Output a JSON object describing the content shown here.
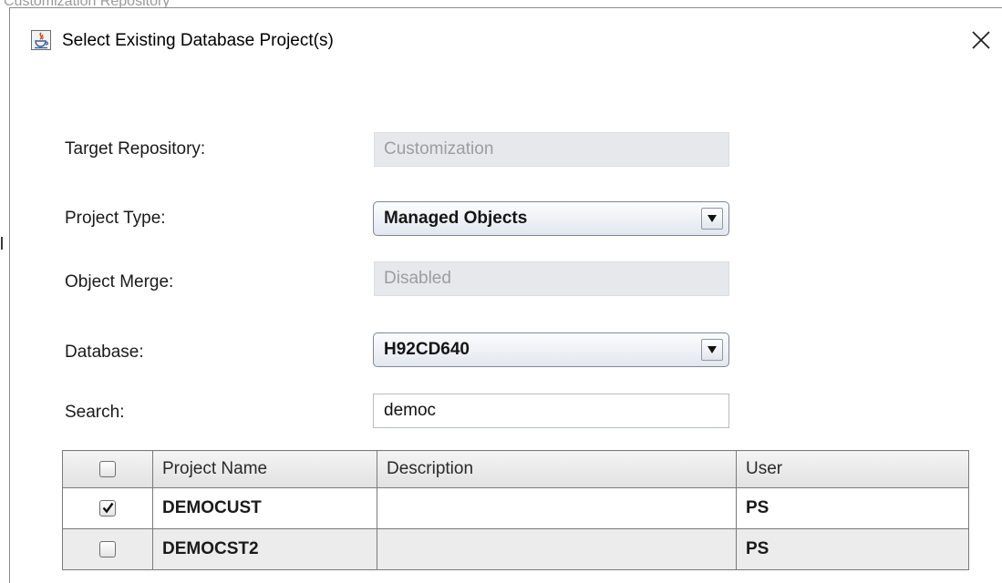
{
  "background_window": {
    "title": "Customization Repository"
  },
  "dialog": {
    "title": "Select Existing Database Project(s)",
    "icon": "java-app-icon",
    "close_icon": "close-icon"
  },
  "form": {
    "target_repository": {
      "label": "Target Repository:",
      "value": "Customization"
    },
    "project_type": {
      "label": "Project Type:",
      "value": "Managed Objects"
    },
    "object_merge": {
      "label": "Object Merge:",
      "value": "Disabled"
    },
    "database": {
      "label": "Database:",
      "value": "H92CD640"
    },
    "search": {
      "label": "Search:",
      "value": "democ"
    }
  },
  "table": {
    "columns": [
      "",
      "Project Name",
      "Description",
      "User"
    ],
    "header_checked": false,
    "rows": [
      {
        "checked": true,
        "project_name": "DEMOCUST",
        "description": "",
        "user": "PS"
      },
      {
        "checked": false,
        "project_name": "DEMOCST2",
        "description": "",
        "user": "PS"
      }
    ]
  },
  "colors": {
    "readonly_field_bg": "#e6e8eb",
    "readonly_text": "#9b9da1",
    "grid_border": "#7a7a7a",
    "alt_row_bg": "#ececec"
  }
}
